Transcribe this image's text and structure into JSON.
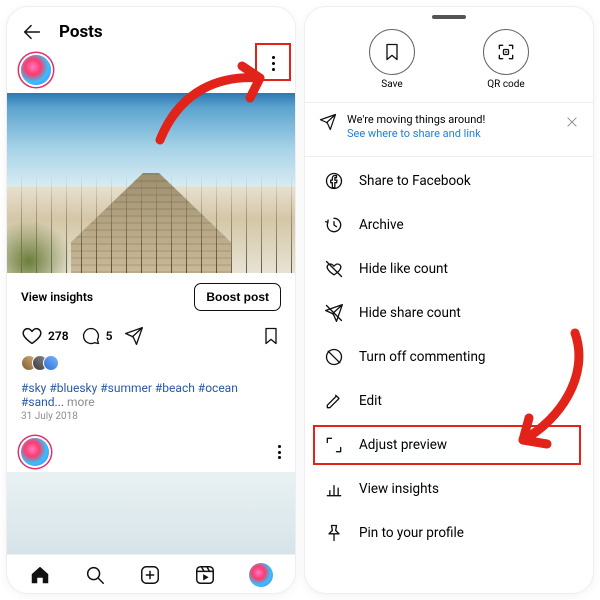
{
  "left": {
    "header_title": "Posts",
    "insights_label": "View insights",
    "boost_label": "Boost post",
    "like_count": "278",
    "comment_count": "5",
    "caption_hashtags": "#sky #bluesky #summer #beach #ocean #sand...",
    "caption_more": " more",
    "post_date": "31 July 2018"
  },
  "right": {
    "save_label": "Save",
    "qr_label": "QR code",
    "banner_title": "We're moving things around!",
    "banner_link": "See where to share and link",
    "menu": {
      "share_fb": "Share to Facebook",
      "archive": "Archive",
      "hide_like": "Hide like count",
      "hide_share": "Hide share count",
      "turn_off_comment": "Turn off commenting",
      "edit": "Edit",
      "adjust_preview": "Adjust preview",
      "view_insights": "View insights",
      "pin": "Pin to your profile"
    }
  },
  "colors": {
    "highlight_red": "#e1231a",
    "link_blue": "#2080d8",
    "hashtag_blue": "#2957a4"
  }
}
